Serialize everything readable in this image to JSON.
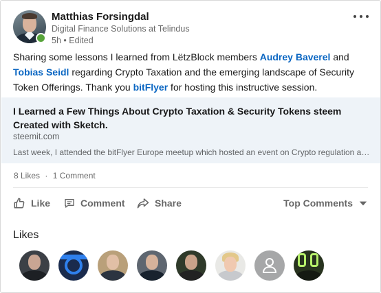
{
  "post": {
    "author": {
      "name": "Matthias Forsingdal",
      "headline": "Digital Finance Solutions at Telindus",
      "meta": "5h • Edited"
    },
    "commentary": {
      "part1": "Sharing some lessons I learned from LëtzBlock members ",
      "mention1": "Audrey Baverel",
      "part2": " and ",
      "mention2": "Tobias Seidl",
      "part3": " regarding Crypto Taxation and the emerging landscape of Security Token Offerings. Thank you ",
      "mention3": "bitFlyer",
      "part4": " for hosting this instructive session."
    },
    "article": {
      "title": "I Learned a Few Things About Crypto Taxation & Security Tokens steem Created with Sketch.",
      "domain": "steemit.com",
      "description": "Last week, I attended the bitFlyer Europe meetup which hosted an event on Crypto regulation and taxation in Europe"
    },
    "social_counts": {
      "likes": "8 Likes",
      "separator": "·",
      "comments": "1 Comment"
    },
    "actions": {
      "like": "Like",
      "comment": "Comment",
      "share": "Share",
      "sort": "Top Comments"
    },
    "likes_section": {
      "title": "Likes",
      "liker_count": 8
    }
  },
  "colors": {
    "link": "#0a66c2",
    "presence": "#57a43a",
    "article_bg": "#eef3f8",
    "muted_text": "rgba(0,0,0,0.6)"
  },
  "icons": [
    "more-icon",
    "like-icon",
    "comment-icon",
    "share-icon",
    "chevron-down-icon",
    "person-placeholder-icon"
  ]
}
